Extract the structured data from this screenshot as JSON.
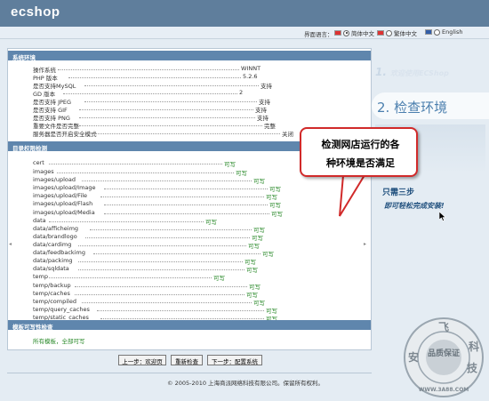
{
  "app": {
    "logo": "ecshop"
  },
  "language": {
    "prompt": "界面语言：",
    "options": [
      "简体中文",
      "繁体中文",
      "English"
    ],
    "selected": "简体中文"
  },
  "system": {
    "heading": "系统环境",
    "rows": [
      {
        "label": "操作系统",
        "value": "WINNT"
      },
      {
        "label": "PHP 版本",
        "value": "5.2.6"
      },
      {
        "label": "是否支持MySQL",
        "value": "支持"
      },
      {
        "label": "GD 版本",
        "value": "2"
      },
      {
        "label": "是否支持 JPEG",
        "value": "支持"
      },
      {
        "label": "是否支持 GIF",
        "value": "支持"
      },
      {
        "label": "是否支持 PNG",
        "value": "支持"
      },
      {
        "label": "重要文件是否完整",
        "value": "完整"
      },
      {
        "label": "服务器是否开启安全模式",
        "value": "关闭"
      }
    ]
  },
  "dirs": {
    "heading": "目录权限检测",
    "rows": [
      {
        "path": "cert",
        "status": "可写"
      },
      {
        "path": "images",
        "status": "可写"
      },
      {
        "path": "images/upload",
        "status": "可写"
      },
      {
        "path": "images/upload/Image",
        "status": "可写"
      },
      {
        "path": "images/upload/File",
        "status": "可写"
      },
      {
        "path": "images/upload/Flash",
        "status": "可写"
      },
      {
        "path": "images/upload/Media",
        "status": "可写"
      },
      {
        "path": "data",
        "status": "可写"
      },
      {
        "path": "data/afficheimg",
        "status": "可写"
      },
      {
        "path": "data/brandlogo",
        "status": "可写"
      },
      {
        "path": "data/cardimg",
        "status": "可写"
      },
      {
        "path": "data/feedbackimg",
        "status": "可写"
      },
      {
        "path": "data/packimg",
        "status": "可写"
      },
      {
        "path": "data/sqldata",
        "status": "可写"
      },
      {
        "path": "temp",
        "status": "可写"
      },
      {
        "path": "temp/backup",
        "status": "可写"
      },
      {
        "path": "temp/caches",
        "status": "可写"
      },
      {
        "path": "temp/compiled",
        "status": "可写"
      },
      {
        "path": "temp/query_caches",
        "status": "可写"
      },
      {
        "path": "temp/static_caches",
        "status": "可写"
      }
    ]
  },
  "templates": {
    "heading": "模板可写性检查",
    "result": "所有模板，全部可写"
  },
  "buttons": {
    "prev": "上一步：欢迎页",
    "recheck": "重新检查",
    "next": "下一步：配置系统"
  },
  "footer": {
    "copyright": "© 2005-2010 上海商派网络科技有限公司。保留所有权利。"
  },
  "sidebar": {
    "step1_num": "1.",
    "step1_text": "欢迎使用ECShop",
    "step2": "2. 检查环境",
    "only_three": "只需三步",
    "easy": "即可轻松完成安装!"
  },
  "callout": {
    "line1": "检测网店运行的各",
    "line2": "种环境是否满足"
  },
  "watermark": {
    "center": "品质保证",
    "ring_top": "飞",
    "ring_right": "科",
    "ring_left": "安",
    "ring_right2": "技",
    "url": "WWW.3A88.COM"
  },
  "colors": {
    "header": "#5f7e9c",
    "section": "#5f86ad",
    "ok_green": "#2a8a2a",
    "callout_border": "#d12a2a"
  }
}
